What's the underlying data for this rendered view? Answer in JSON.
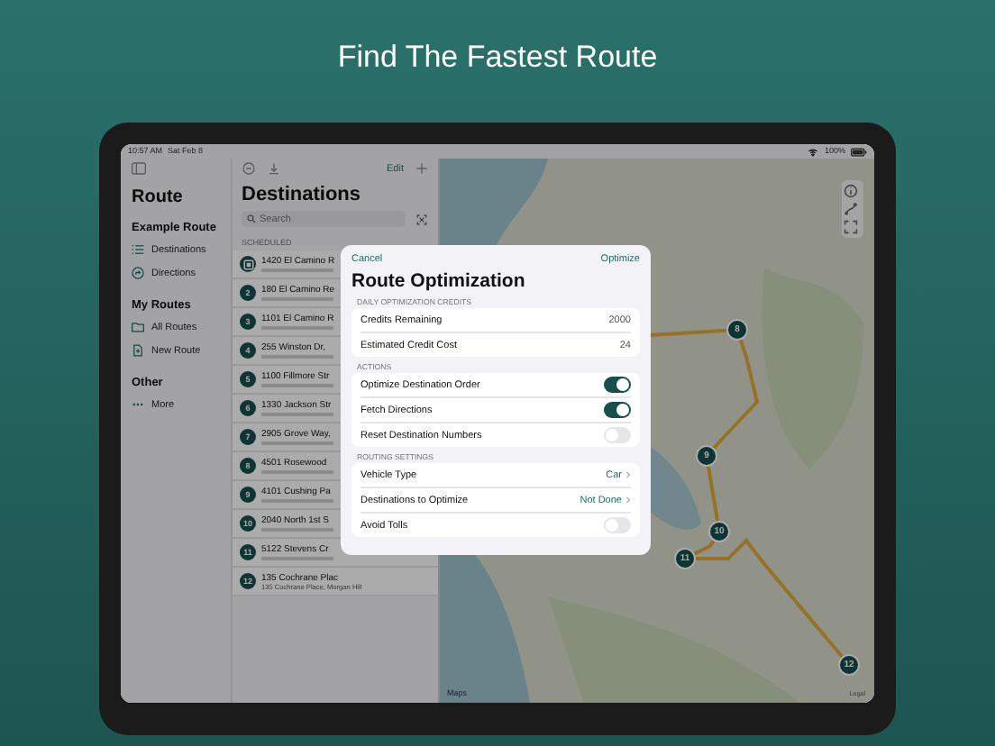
{
  "headline": "Find The Fastest Route",
  "status_bar": {
    "time": "10:57 AM",
    "date": "Sat Feb 8",
    "battery": "100%"
  },
  "sidebar": {
    "title": "Route",
    "sections": [
      {
        "heading": "Example Route",
        "items": [
          {
            "label": "Destinations"
          },
          {
            "label": "Directions"
          }
        ]
      },
      {
        "heading": "My Routes",
        "items": [
          {
            "label": "All Routes"
          },
          {
            "label": "New Route"
          }
        ]
      },
      {
        "heading": "Other",
        "items": [
          {
            "label": "More"
          }
        ]
      }
    ]
  },
  "list": {
    "edit": "Edit",
    "title": "Destinations",
    "search": {
      "placeholder": "Search"
    },
    "section": "SCHEDULED",
    "rows": [
      {
        "kind": "start",
        "number": "",
        "name": "1420 El Camino R"
      },
      {
        "kind": "stop",
        "number": "2",
        "name": "180 El Camino Re"
      },
      {
        "kind": "stop",
        "number": "3",
        "name": "1101 El Camino R"
      },
      {
        "kind": "stop",
        "number": "4",
        "name": "255 Winston Dr,"
      },
      {
        "kind": "stop",
        "number": "5",
        "name": "1100 Fillmore Str"
      },
      {
        "kind": "stop",
        "number": "6",
        "name": "1330 Jackson Str"
      },
      {
        "kind": "stop",
        "number": "7",
        "name": "2905 Grove Way,"
      },
      {
        "kind": "stop",
        "number": "8",
        "name": "4501 Rosewood"
      },
      {
        "kind": "stop",
        "number": "9",
        "name": "4101 Cushing Pa"
      },
      {
        "kind": "stop",
        "number": "10",
        "name": "2040 North 1st S"
      },
      {
        "kind": "stop",
        "number": "11",
        "name": "5122 Stevens Cr"
      },
      {
        "kind": "stop",
        "number": "12",
        "name": "135 Cochrane Plac",
        "subtitle": "135 Cochrane Place, Morgan Hill"
      }
    ]
  },
  "modal": {
    "cancel": "Cancel",
    "confirm": "Optimize",
    "title": "Route Optimization",
    "sections": [
      {
        "header": "DAILY OPTIMIZATION CREDITS",
        "rows": [
          {
            "kind": "value",
            "label": "Credits Remaining",
            "value": "2000"
          },
          {
            "kind": "value",
            "label": "Estimated Credit Cost",
            "value": "24"
          }
        ]
      },
      {
        "header": "ACTIONS",
        "rows": [
          {
            "kind": "toggle",
            "label": "Optimize Destination Order",
            "on": true
          },
          {
            "kind": "toggle",
            "label": "Fetch Directions",
            "on": true
          },
          {
            "kind": "toggle",
            "label": "Reset Destination Numbers",
            "on": false
          }
        ]
      },
      {
        "header": "ROUTING SETTINGS",
        "rows": [
          {
            "kind": "link",
            "label": "Vehicle Type",
            "value": "Car"
          },
          {
            "kind": "link",
            "label": "Destinations to Optimize",
            "value": "Not Done"
          },
          {
            "kind": "toggle",
            "label": "Avoid Tolls",
            "on": false
          }
        ]
      }
    ]
  },
  "map": {
    "markers": [
      {
        "number": "8"
      },
      {
        "number": "9"
      },
      {
        "number": "10"
      },
      {
        "number": "11"
      },
      {
        "number": "12"
      }
    ],
    "attribution": "Maps",
    "legal": "Legal"
  }
}
